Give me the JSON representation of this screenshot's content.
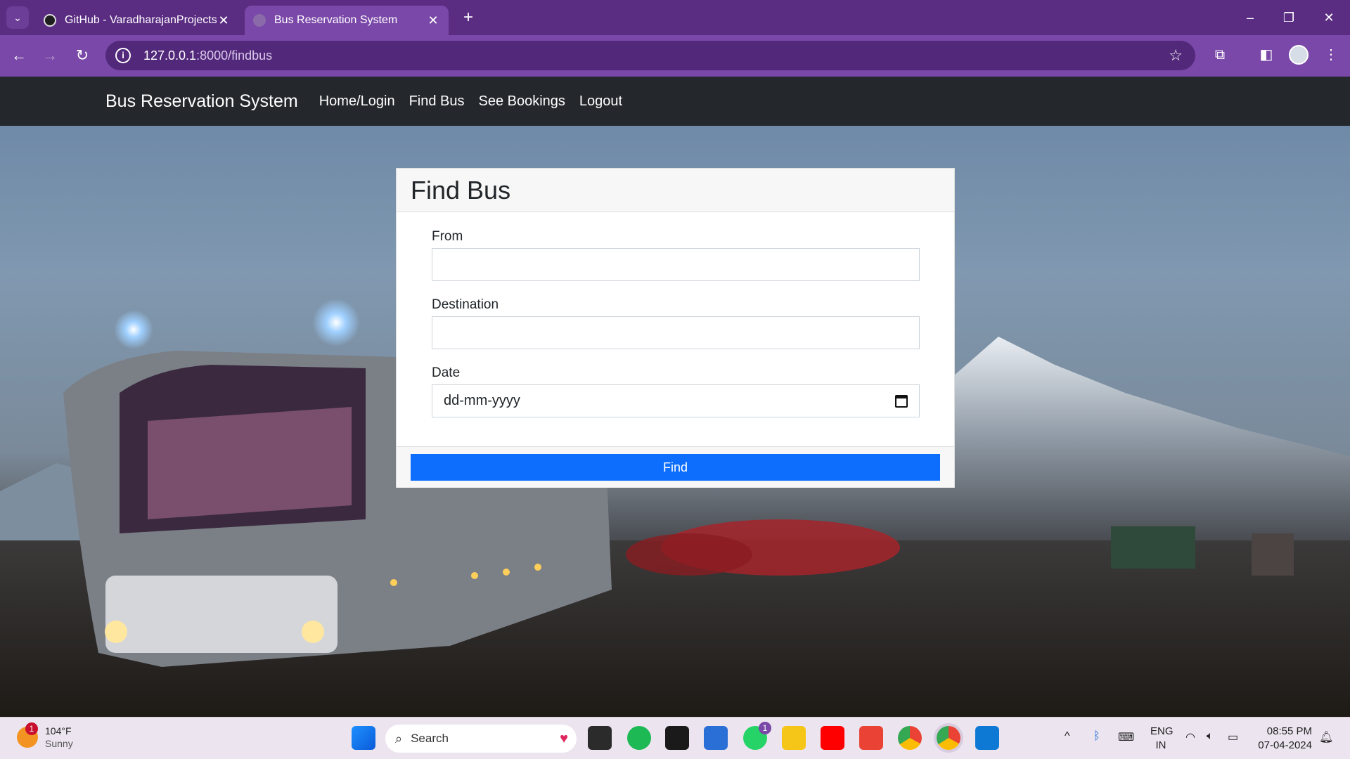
{
  "browser": {
    "tabs": [
      {
        "title": "GitHub - VaradharajanProjects/",
        "active": false
      },
      {
        "title": "Bus Reservation System",
        "active": true
      }
    ],
    "new_tab_symbol": "+",
    "url_host": "127.0.0.1",
    "url_path": ":8000/findbus",
    "window_controls": {
      "minimize": "–",
      "restore": "❐",
      "close": "✕"
    }
  },
  "site": {
    "brand": "Bus Reservation System",
    "nav": [
      "Home/Login",
      "Find Bus",
      "See Bookings",
      "Logout"
    ]
  },
  "form": {
    "title": "Find Bus",
    "from_label": "From",
    "from_value": "",
    "destination_label": "Destination",
    "destination_value": "",
    "date_label": "Date",
    "date_placeholder": "dd-mm-yyyy",
    "submit_label": "Find"
  },
  "taskbar": {
    "weather_temp": "104°F",
    "weather_condition": "Sunny",
    "weather_badge": "1",
    "search_label": "Search",
    "whatsapp_badge": "1",
    "language": "ENG",
    "region": "IN",
    "time": "08:55 PM",
    "date": "07-04-2024"
  },
  "colors": {
    "tabstrip": "#5a2d82",
    "toolbar": "#7a48a8",
    "site_nav": "#24272b",
    "primary_button": "#0d6efd"
  }
}
